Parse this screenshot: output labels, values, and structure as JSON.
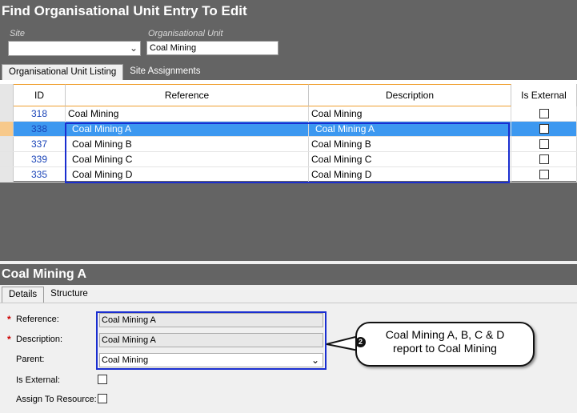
{
  "page_title": "Find Organisational Unit Entry To Edit",
  "filters": {
    "site_label": "Site",
    "site_value": "",
    "org_unit_label": "Organisational Unit",
    "org_unit_value": "Coal Mining"
  },
  "tabs_top": [
    {
      "label": "Organisational Unit Listing",
      "active": true
    },
    {
      "label": "Site Assignments",
      "active": false
    }
  ],
  "grid": {
    "columns": [
      "ID",
      "Reference",
      "Description",
      "Is External"
    ],
    "rows": [
      {
        "id": "318",
        "reference": "Coal Mining",
        "description": "Coal Mining",
        "is_external": false
      },
      {
        "id": "338",
        "reference": "Coal Mining A",
        "description": "Coal Mining A",
        "is_external": false,
        "selected": true
      },
      {
        "id": "337",
        "reference": "Coal Mining B",
        "description": "Coal Mining B",
        "is_external": false
      },
      {
        "id": "339",
        "reference": "Coal Mining C",
        "description": "Coal Mining C",
        "is_external": false
      },
      {
        "id": "335",
        "reference": "Coal Mining D",
        "description": "Coal Mining D",
        "is_external": false
      }
    ]
  },
  "detail": {
    "title": "Coal Mining A",
    "tabs": [
      {
        "label": "Details",
        "active": true
      },
      {
        "label": "Structure",
        "active": false
      }
    ],
    "reference_label": "Reference:",
    "reference_value": "Coal Mining A",
    "description_label": "Description:",
    "description_value": "Coal Mining A",
    "parent_label": "Parent:",
    "parent_value": "Coal Mining",
    "is_external_label": "Is External:",
    "assign_label": "Assign To Resource:"
  },
  "callout": {
    "number": "2",
    "line1": "Coal Mining A, B, C & D",
    "line2": "report to Coal Mining"
  },
  "colors": {
    "selection": "#3c98f0",
    "highlight_border": "#1a2ed0",
    "header_panel": "#646464"
  }
}
